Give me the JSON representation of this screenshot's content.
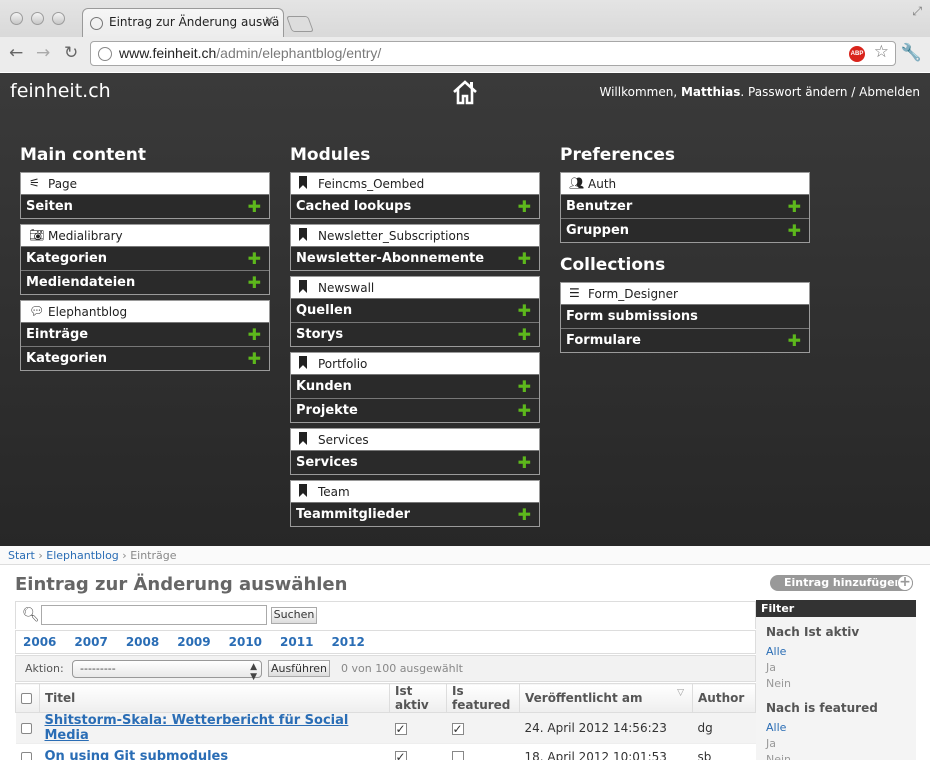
{
  "browser": {
    "tab_title": "Eintrag zur Änderung auswä",
    "url_domain": "www.feinheit.ch",
    "url_path": "/admin/elephantblog/entry/",
    "abp_label": "ABP"
  },
  "header": {
    "brand": "feinheit.ch",
    "welcome": "Willkommen, ",
    "username": "Matthias",
    "change_password": "Passwort ändern",
    "sep": " / ",
    "logout": "Abmelden"
  },
  "columns": {
    "main_title": "Main content",
    "modules_title": "Modules",
    "prefs_title": "Preferences",
    "collections_title": "Collections"
  },
  "main_content": [
    {
      "name": "Page",
      "icon": "tree-icon",
      "rows": [
        {
          "label": "Seiten",
          "add": true
        }
      ]
    },
    {
      "name": "Medialibrary",
      "icon": "camera-icon",
      "rows": [
        {
          "label": "Kategorien",
          "add": true
        },
        {
          "label": "Mediendateien",
          "add": true
        }
      ]
    },
    {
      "name": "Elephantblog",
      "icon": "speech-bubbles-icon",
      "rows": [
        {
          "label": "Einträge",
          "add": true
        },
        {
          "label": "Kategorien",
          "add": true
        }
      ]
    }
  ],
  "modules": [
    {
      "name": "Feincms_Oembed",
      "rows": [
        {
          "label": "Cached lookups",
          "add": true
        }
      ]
    },
    {
      "name": "Newsletter_Subscriptions",
      "rows": [
        {
          "label": "Newsletter-Abonnemente",
          "add": true
        }
      ]
    },
    {
      "name": "Newswall",
      "rows": [
        {
          "label": "Quellen",
          "add": true
        },
        {
          "label": "Storys",
          "add": true
        }
      ]
    },
    {
      "name": "Portfolio",
      "rows": [
        {
          "label": "Kunden",
          "add": true
        },
        {
          "label": "Projekte",
          "add": true
        }
      ]
    },
    {
      "name": "Services",
      "rows": [
        {
          "label": "Services",
          "add": true
        }
      ]
    },
    {
      "name": "Team",
      "rows": [
        {
          "label": "Teammitglieder",
          "add": true
        }
      ]
    }
  ],
  "preferences": [
    {
      "name": "Auth",
      "icon": "users-icon",
      "rows": [
        {
          "label": "Benutzer",
          "add": true
        },
        {
          "label": "Gruppen",
          "add": true
        }
      ]
    }
  ],
  "collections": [
    {
      "name": "Form_Designer",
      "icon": "list-icon",
      "rows": [
        {
          "label": "Form submissions",
          "add": false
        },
        {
          "label": "Formulare",
          "add": true
        }
      ]
    }
  ],
  "breadcrumb": {
    "start": "Start",
    "section": "Elephantblog",
    "current": "Einträge",
    "sep": " › "
  },
  "page": {
    "title": "Eintrag zur Änderung auswählen",
    "add_button": "Eintrag hinzufügen",
    "search_button": "Suchen",
    "years": [
      "2006",
      "2007",
      "2008",
      "2009",
      "2010",
      "2011",
      "2012"
    ],
    "action_label": "Aktion:",
    "action_value": "---------",
    "go_button": "Ausführen",
    "selected_count": "0 von 100 ausgewählt"
  },
  "table": {
    "headers": [
      "Titel",
      "Ist aktiv",
      "Is featured",
      "Veröffentlicht am",
      "Author"
    ],
    "rows": [
      {
        "title": "Shitstorm-Skala: Wetterbericht für Social Media",
        "active": true,
        "featured": true,
        "published": "24. April 2012 14:56:23",
        "author": "dg"
      },
      {
        "title": "On using Git submodules",
        "active": true,
        "featured": false,
        "published": "18. April 2012 10:01:53",
        "author": "sb"
      }
    ]
  },
  "filter": {
    "title": "Filter",
    "groups": [
      {
        "heading": "Nach Ist aktiv",
        "options": [
          "Alle",
          "Ja",
          "Nein"
        ]
      },
      {
        "heading": "Nach is featured",
        "options": [
          "Alle",
          "Ja",
          "Nein"
        ]
      }
    ]
  }
}
